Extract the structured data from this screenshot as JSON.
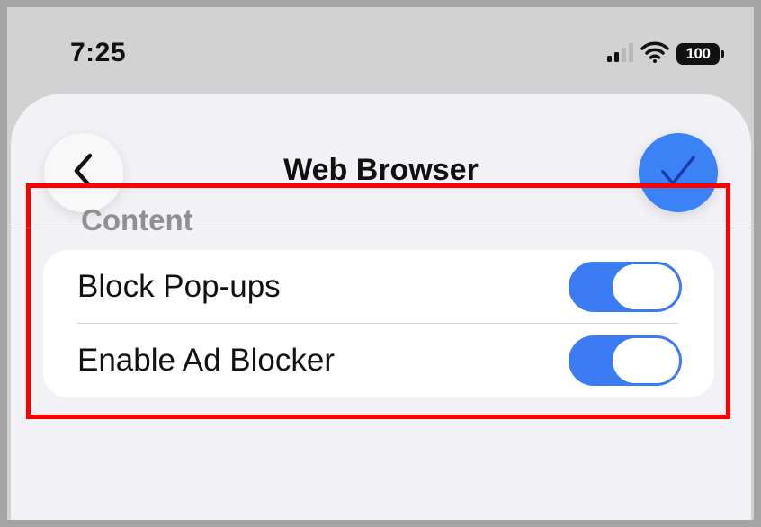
{
  "status_bar": {
    "time": "7:25",
    "battery": "100",
    "icons": [
      "cellular-signal-icon",
      "wifi-icon",
      "battery-icon"
    ]
  },
  "nav": {
    "title": "Web Browser",
    "back_icon": "chevron-left-icon",
    "done_icon": "checkmark-icon"
  },
  "section": {
    "header": "Content",
    "rows": [
      {
        "label": "Block Pop-ups",
        "toggle_on": true
      },
      {
        "label": "Enable Ad Blocker",
        "toggle_on": true
      }
    ]
  },
  "colors": {
    "accent": "#3b82f6",
    "toggle_on": "#3b7bf4",
    "highlight": "#ff0000",
    "background": "#f2f2f6"
  }
}
